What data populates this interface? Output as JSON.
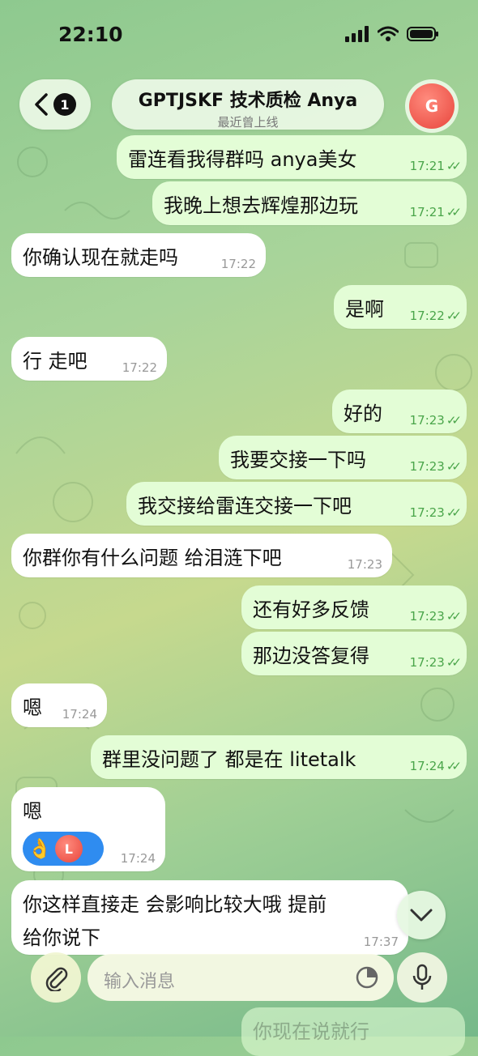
{
  "status": {
    "time": "22:10"
  },
  "header": {
    "back_badge": "1",
    "title": "GPTJSKF 技术质检 Anya",
    "subtitle": "最近曾上线",
    "avatar_letter": "G"
  },
  "messages": [
    {
      "dir": "out",
      "text": "雷连看我得群吗 anya美女",
      "time": "17:21"
    },
    {
      "dir": "out",
      "text": "我晚上想去辉煌那边玩",
      "time": "17:21"
    },
    {
      "dir": "in",
      "text": "你确认现在就走吗",
      "time": "17:22"
    },
    {
      "dir": "out",
      "text": "是啊",
      "time": "17:22"
    },
    {
      "dir": "in",
      "text": "行   走吧",
      "time": "17:22"
    },
    {
      "dir": "out",
      "text": "好的",
      "time": "17:23"
    },
    {
      "dir": "out",
      "text": "我要交接一下吗",
      "time": "17:23"
    },
    {
      "dir": "out",
      "text": "我交接给雷连交接一下吧",
      "time": "17:23"
    },
    {
      "dir": "in",
      "text": "你群你有什么问题  给泪涟下吧",
      "time": "17:23"
    },
    {
      "dir": "out",
      "text": "还有好多反馈",
      "time": "17:23"
    },
    {
      "dir": "out",
      "text": "那边没答复得",
      "time": "17:23"
    },
    {
      "dir": "in",
      "text": "嗯",
      "time": "17:24"
    },
    {
      "dir": "out",
      "text": "群里没问题了 都是在 litetalk",
      "time": "17:24"
    },
    {
      "dir": "in",
      "text": "嗯",
      "time": "17:24",
      "reaction": {
        "emoji": "👌",
        "avatar_letter": "L"
      }
    },
    {
      "dir": "in",
      "text_line1": "你这样直接走  会影响比较大哦   提前",
      "text_line2": "给你说下",
      "time": "17:37"
    }
  ],
  "peek_message": "你现在说就行",
  "composer": {
    "placeholder": "输入消息"
  },
  "colors": {
    "outgoing_bubble": "#e3fdd6",
    "incoming_bubble": "#ffffff",
    "check_color": "#4aa54a"
  }
}
